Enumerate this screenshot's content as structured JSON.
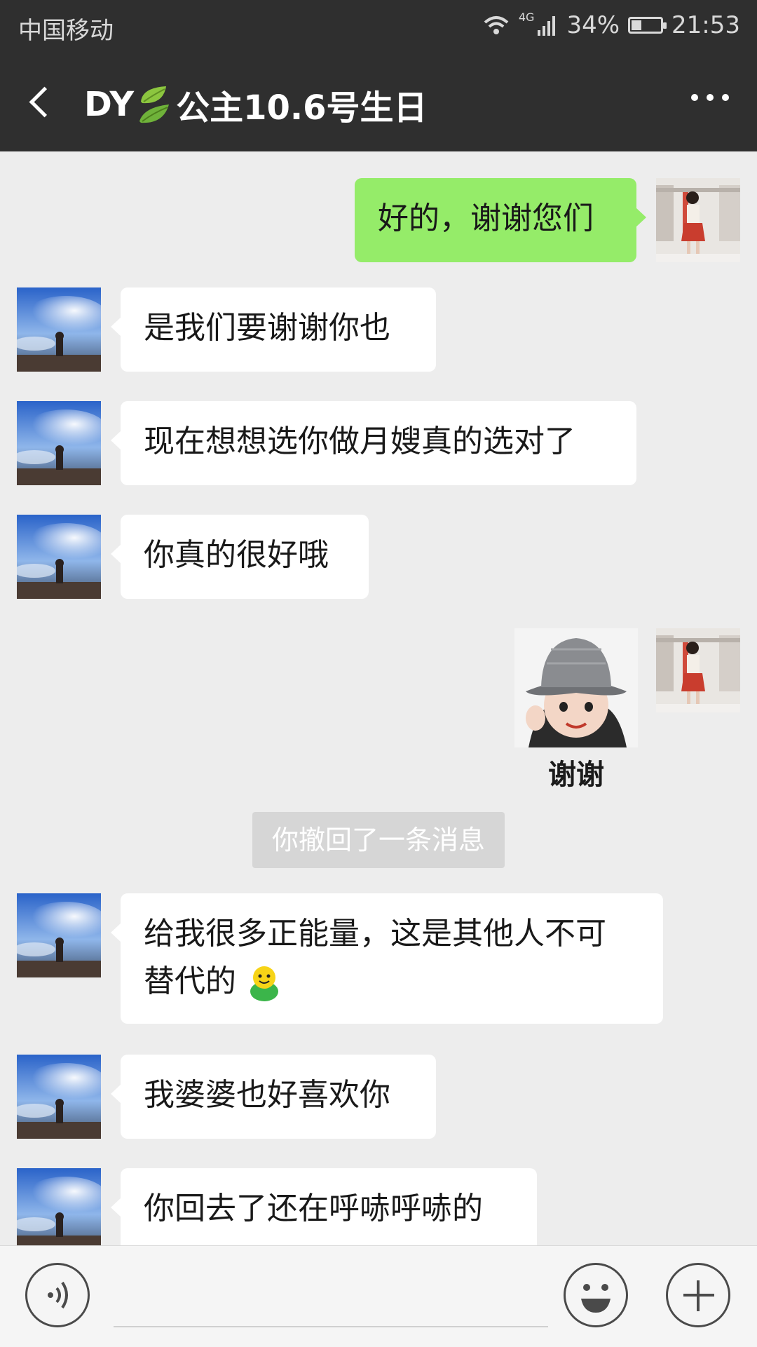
{
  "status_bar": {
    "carrier": "中国移动",
    "network": "4G",
    "battery_percent": "34%",
    "battery_level": 0.34,
    "time": "21:53"
  },
  "title_bar": {
    "title_prefix": "DY",
    "title_suffix": "公主10.6号生日",
    "leaf_icon": "leaf-emoji-icon"
  },
  "messages": [
    {
      "side": "out",
      "type": "text",
      "text": "好的，谢谢您们"
    },
    {
      "side": "in",
      "type": "text",
      "text": "是我们要谢谢你也"
    },
    {
      "side": "in",
      "type": "text",
      "text": "现在想想选你做月嫂真的选对了"
    },
    {
      "side": "in",
      "type": "text",
      "text": "你真的很好哦"
    },
    {
      "side": "out",
      "type": "sticker",
      "caption": "谢谢"
    },
    {
      "type": "system",
      "text": "你撤回了一条消息"
    },
    {
      "side": "in",
      "type": "text",
      "line1": "给我很多正能量，这是其他人不可",
      "line2": "替代的",
      "emoji": "smile-emoji-icon"
    },
    {
      "side": "in",
      "type": "text",
      "text": "我婆婆也好喜欢你"
    },
    {
      "side": "in",
      "type": "text",
      "text": "你回去了还在呼哧呼哧的"
    }
  ],
  "colors": {
    "header_bg": "#2f2f2f",
    "chat_bg": "#ededed",
    "outgoing_bubble": "#95ec69",
    "incoming_bubble": "#ffffff"
  }
}
